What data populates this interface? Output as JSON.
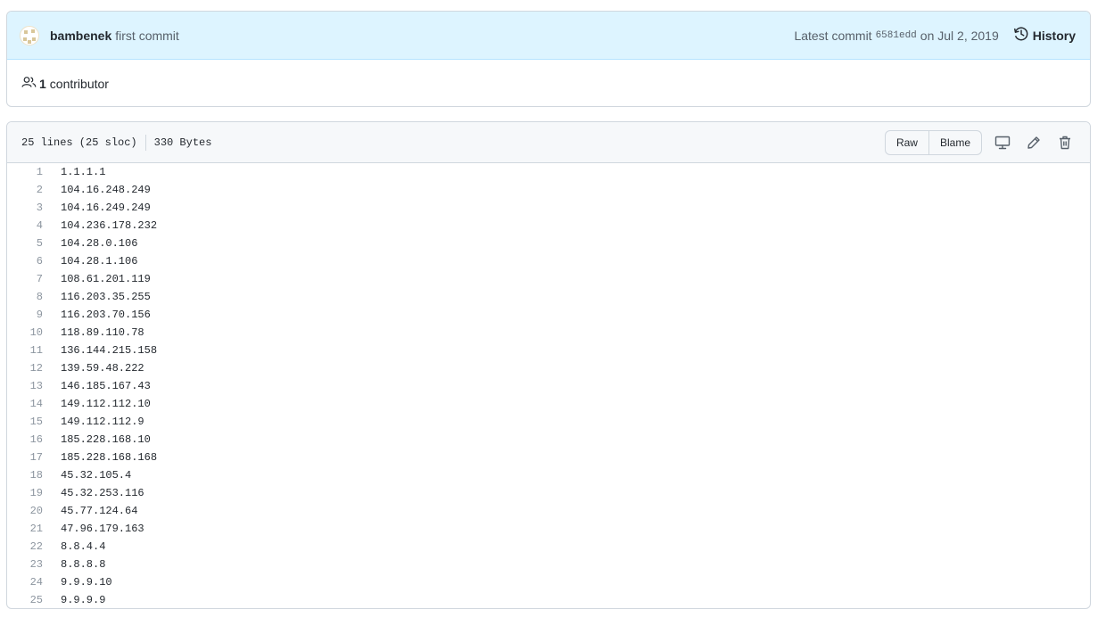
{
  "commit": {
    "author": "bambenek",
    "message": "first commit",
    "latest_label": "Latest commit",
    "sha": "6581edd",
    "date": "on Jul 2, 2019",
    "history_label": "History",
    "contributor_count": "1",
    "contributor_label": "contributor"
  },
  "file": {
    "lines_info": "25 lines (25 sloc)",
    "size": "330 Bytes",
    "raw_label": "Raw",
    "blame_label": "Blame",
    "icons": [
      "desktop-icon",
      "pencil-icon",
      "trash-icon"
    ]
  },
  "code_lines": [
    {
      "n": "1",
      "text": "1.1.1.1"
    },
    {
      "n": "2",
      "text": "104.16.248.249"
    },
    {
      "n": "3",
      "text": "104.16.249.249"
    },
    {
      "n": "4",
      "text": "104.236.178.232"
    },
    {
      "n": "5",
      "text": "104.28.0.106"
    },
    {
      "n": "6",
      "text": "104.28.1.106"
    },
    {
      "n": "7",
      "text": "108.61.201.119"
    },
    {
      "n": "8",
      "text": "116.203.35.255"
    },
    {
      "n": "9",
      "text": "116.203.70.156"
    },
    {
      "n": "10",
      "text": "118.89.110.78"
    },
    {
      "n": "11",
      "text": "136.144.215.158"
    },
    {
      "n": "12",
      "text": "139.59.48.222"
    },
    {
      "n": "13",
      "text": "146.185.167.43"
    },
    {
      "n": "14",
      "text": "149.112.112.10"
    },
    {
      "n": "15",
      "text": "149.112.112.9"
    },
    {
      "n": "16",
      "text": "185.228.168.10"
    },
    {
      "n": "17",
      "text": "185.228.168.168"
    },
    {
      "n": "18",
      "text": "45.32.105.4"
    },
    {
      "n": "19",
      "text": "45.32.253.116"
    },
    {
      "n": "20",
      "text": "45.77.124.64"
    },
    {
      "n": "21",
      "text": "47.96.179.163"
    },
    {
      "n": "22",
      "text": "8.8.4.4"
    },
    {
      "n": "23",
      "text": "8.8.8.8"
    },
    {
      "n": "24",
      "text": "9.9.9.10"
    },
    {
      "n": "25",
      "text": "9.9.9.9"
    }
  ],
  "colors": {
    "commit_header_bg": "#ddf4ff",
    "file_header_bg": "#f6f8fa",
    "border": "#d0d7de",
    "line_number": "#8c959f"
  }
}
